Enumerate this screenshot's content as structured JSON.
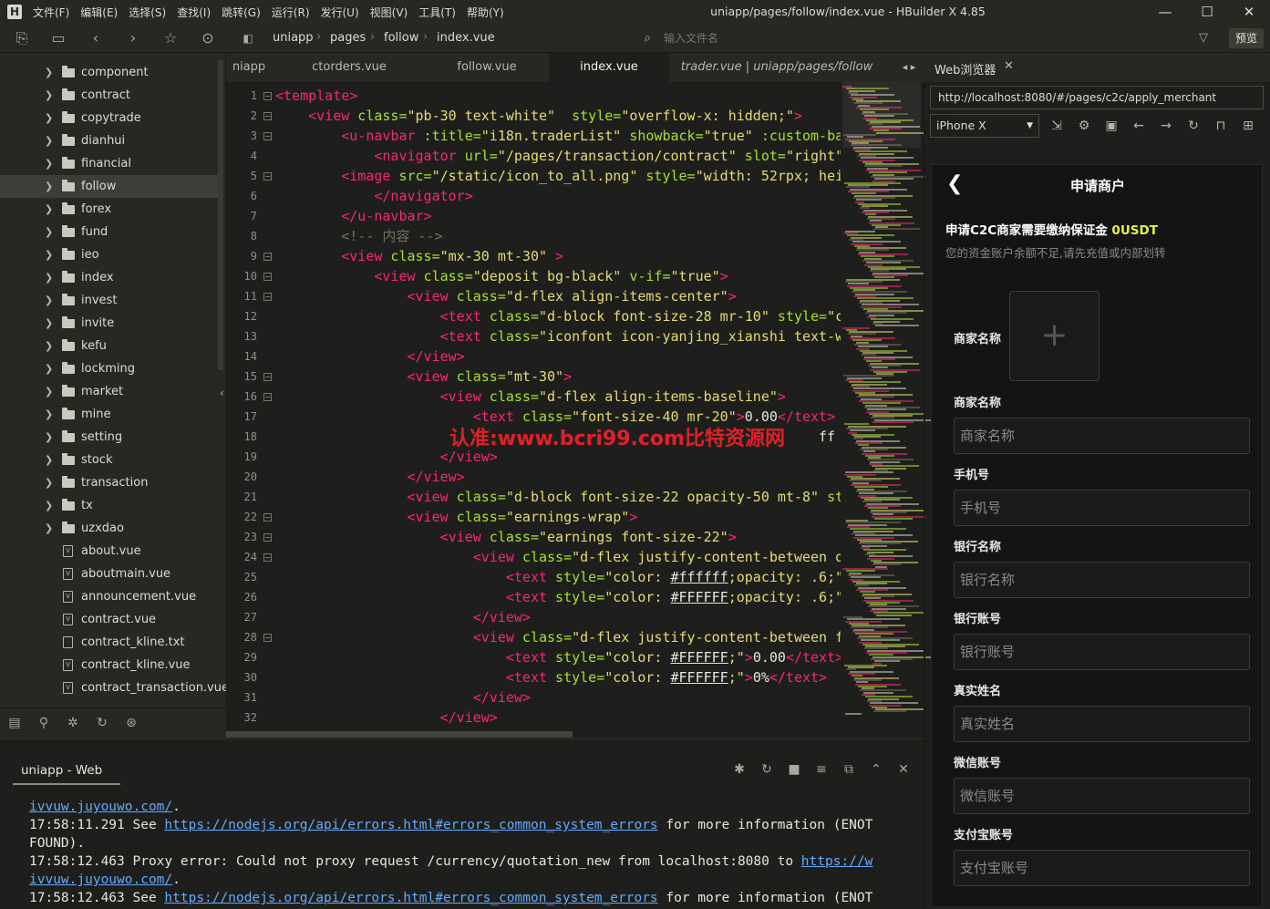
{
  "menu": {
    "items": [
      "文件(F)",
      "编辑(E)",
      "选择(S)",
      "查找(I)",
      "跳转(G)",
      "运行(R)",
      "发行(U)",
      "视图(V)",
      "工具(T)",
      "帮助(Y)"
    ],
    "window_title": "uniapp/pages/follow/index.vue - HBuilder X 4.85",
    "logo": "H",
    "controls": [
      "minimize-icon",
      "maximize-icon",
      "close-icon"
    ]
  },
  "toolbar": {
    "breadcrumb": [
      "uniapp",
      "pages",
      "follow",
      "index.vue"
    ],
    "search_placeholder": "输入文件名",
    "preview_label": "预览"
  },
  "sidebar": {
    "folders": [
      "component",
      "contract",
      "copytrade",
      "dianhui",
      "financial",
      "follow",
      "forex",
      "fund",
      "ieo",
      "index",
      "invest",
      "invite",
      "kefu",
      "lockming",
      "market",
      "mine",
      "setting",
      "stock",
      "transaction",
      "tx",
      "uzxdao"
    ],
    "files": [
      "about.vue",
      "aboutmain.vue",
      "announcement.vue",
      "contract.vue",
      "contract_kline.txt",
      "contract_kline.vue",
      "contract_transaction.vue"
    ],
    "active": "follow"
  },
  "tabs": [
    "niapp",
    "ctorders.vue",
    "follow.vue",
    "index.vue",
    "trader.vue | uniapp/pages/follow"
  ],
  "active_tab": "index.vue",
  "code": {
    "lines": [
      [
        [
          "t",
          "<template>"
        ]
      ],
      [
        [
          "e",
          "    "
        ],
        [
          "t",
          "<view"
        ],
        [
          "a",
          " class="
        ],
        [
          "s",
          "\"pb-30 text-white\""
        ],
        [
          "a",
          "  style="
        ],
        [
          "s",
          "\"overflow-x: hidden;\""
        ],
        [
          "t",
          ">"
        ]
      ],
      [
        [
          "e",
          "        "
        ],
        [
          "t",
          "<u-navbar"
        ],
        [
          "a",
          " :title="
        ],
        [
          "s",
          "\"i18n.traderList\""
        ],
        [
          "a",
          " showback="
        ],
        [
          "s",
          "\"true\""
        ],
        [
          "a",
          " :custom-ba"
        ]
      ],
      [
        [
          "e",
          "            "
        ],
        [
          "t",
          "<navigator"
        ],
        [
          "a",
          " url="
        ],
        [
          "s",
          "\"/pages/transaction/contract\""
        ],
        [
          "a",
          " slot="
        ],
        [
          "s",
          "\"right\""
        ]
      ],
      [
        [
          "e",
          "        "
        ],
        [
          "t",
          "<image"
        ],
        [
          "a",
          " src="
        ],
        [
          "s",
          "\"/static/icon_to_all.png\""
        ],
        [
          "a",
          " style="
        ],
        [
          "s",
          "\"width: 52rpx; hei"
        ]
      ],
      [
        [
          "e",
          "            "
        ],
        [
          "t",
          "</navigator>"
        ]
      ],
      [
        [
          "e",
          "        "
        ],
        [
          "t",
          "</u-navbar>"
        ]
      ],
      [
        [
          "e",
          "        "
        ],
        [
          "c",
          "<!-- 内容 -->"
        ]
      ],
      [
        [
          "e",
          "        "
        ],
        [
          "t",
          "<view"
        ],
        [
          "a",
          " class="
        ],
        [
          "s",
          "\"mx-30 mt-30\""
        ],
        [
          "t",
          " >"
        ]
      ],
      [
        [
          "e",
          "            "
        ],
        [
          "t",
          "<view"
        ],
        [
          "a",
          " class="
        ],
        [
          "s",
          "\"deposit bg-black\""
        ],
        [
          "a",
          " v-if="
        ],
        [
          "s",
          "\"true\""
        ],
        [
          "t",
          ">"
        ]
      ],
      [
        [
          "e",
          "                "
        ],
        [
          "t",
          "<view"
        ],
        [
          "a",
          " class="
        ],
        [
          "s",
          "\"d-flex align-items-center\""
        ],
        [
          "t",
          ">"
        ]
      ],
      [
        [
          "e",
          "                    "
        ],
        [
          "t",
          "<text"
        ],
        [
          "a",
          " class="
        ],
        [
          "s",
          "\"d-block font-size-28 mr-10\""
        ],
        [
          "a",
          " style="
        ],
        [
          "s",
          "\"c"
        ]
      ],
      [
        [
          "e",
          "                    "
        ],
        [
          "t",
          "<text"
        ],
        [
          "a",
          " class="
        ],
        [
          "s",
          "\"iconfont icon-yanjing_xianshi text-w"
        ]
      ],
      [
        [
          "e",
          "                "
        ],
        [
          "t",
          "</view>"
        ]
      ],
      [
        [
          "e",
          "                "
        ],
        [
          "t",
          "<view"
        ],
        [
          "a",
          " class="
        ],
        [
          "s",
          "\"mt-30\""
        ],
        [
          "t",
          ">"
        ]
      ],
      [
        [
          "e",
          "                    "
        ],
        [
          "t",
          "<view"
        ],
        [
          "a",
          " class="
        ],
        [
          "s",
          "\"d-flex align-items-baseline\""
        ],
        [
          "t",
          ">"
        ]
      ],
      [
        [
          "e",
          "                        "
        ],
        [
          "t",
          "<text"
        ],
        [
          "a",
          " class="
        ],
        [
          "s",
          "\"font-size-40 mr-20\""
        ],
        [
          "t",
          ">"
        ],
        [
          "e",
          "0.00"
        ],
        [
          "t",
          "</text>"
        ]
      ],
      [
        [
          "e",
          "                                                                  ff"
        ]
      ],
      [
        [
          "e",
          "                    "
        ],
        [
          "t",
          "</view>"
        ]
      ],
      [
        [
          "e",
          "                "
        ],
        [
          "t",
          "</view>"
        ]
      ],
      [
        [
          "e",
          "                "
        ],
        [
          "t",
          "<view"
        ],
        [
          "a",
          " class="
        ],
        [
          "s",
          "\"d-block font-size-22 opacity-50 mt-8\""
        ],
        [
          "a",
          " st"
        ]
      ],
      [
        [
          "e",
          "                "
        ],
        [
          "t",
          "<view"
        ],
        [
          "a",
          " class="
        ],
        [
          "s",
          "\"earnings-wrap\""
        ],
        [
          "t",
          ">"
        ]
      ],
      [
        [
          "e",
          "                    "
        ],
        [
          "t",
          "<view"
        ],
        [
          "a",
          " class="
        ],
        [
          "s",
          "\"earnings font-size-22\""
        ],
        [
          "t",
          ">"
        ]
      ],
      [
        [
          "e",
          "                        "
        ],
        [
          "t",
          "<view"
        ],
        [
          "a",
          " class="
        ],
        [
          "s",
          "\"d-flex justify-content-between o"
        ]
      ],
      [
        [
          "e",
          "                            "
        ],
        [
          "t",
          "<text"
        ],
        [
          "a",
          " style="
        ],
        [
          "s",
          "\"color: "
        ],
        [
          "u",
          "#ffffff"
        ],
        [
          "s",
          ";opacity: .6;\""
        ]
      ],
      [
        [
          "e",
          "                            "
        ],
        [
          "t",
          "<text"
        ],
        [
          "a",
          " style="
        ],
        [
          "s",
          "\"color: "
        ],
        [
          "u",
          "#FFFFFF"
        ],
        [
          "s",
          ";opacity: .6;\""
        ]
      ],
      [
        [
          "e",
          "                        "
        ],
        [
          "t",
          "</view>"
        ]
      ],
      [
        [
          "e",
          "                        "
        ],
        [
          "t",
          "<view"
        ],
        [
          "a",
          " class="
        ],
        [
          "s",
          "\"d-flex justify-content-between f"
        ]
      ],
      [
        [
          "e",
          "                            "
        ],
        [
          "t",
          "<text"
        ],
        [
          "a",
          " style="
        ],
        [
          "s",
          "\"color: "
        ],
        [
          "u",
          "#FFFFFF"
        ],
        [
          "s",
          ";\""
        ],
        [
          "t",
          ">"
        ],
        [
          "e",
          "0.00"
        ],
        [
          "t",
          "</text>"
        ]
      ],
      [
        [
          "e",
          "                            "
        ],
        [
          "t",
          "<text"
        ],
        [
          "a",
          " style="
        ],
        [
          "s",
          "\"color: "
        ],
        [
          "u",
          "#FFFFFF"
        ],
        [
          "s",
          ";\""
        ],
        [
          "t",
          ">"
        ],
        [
          "e",
          "0%"
        ],
        [
          "t",
          "</text>"
        ]
      ],
      [
        [
          "e",
          "                        "
        ],
        [
          "t",
          "</view>"
        ]
      ],
      [
        [
          "e",
          "                    "
        ],
        [
          "t",
          "</view>"
        ]
      ]
    ]
  },
  "watermark": "认准:www.bcri99.com比特资源网",
  "console": {
    "tab": "uniapp - Web",
    "lines": [
      [
        [
          "l",
          "ivvuw.juyouwo.com/"
        ],
        [
          "e",
          "."
        ]
      ],
      [
        [
          "e",
          "17:58:11.291 See "
        ],
        [
          "l",
          "https://nodejs.org/api/errors.html#errors_common_system_errors"
        ],
        [
          "e",
          " for more information (ENOT"
        ]
      ],
      [
        [
          "e",
          "FOUND)."
        ]
      ],
      [
        [
          "e",
          "17:58:12.463 Proxy error: Could not proxy request /currency/quotation_new from localhost:8080 to "
        ],
        [
          "l",
          "https://w"
        ]
      ],
      [
        [
          "l",
          "ivvuw.juyouwo.com/"
        ],
        [
          "e",
          "."
        ]
      ],
      [
        [
          "e",
          "17:58:12.463 See "
        ],
        [
          "l",
          "https://nodejs.org/api/errors.html#errors_common_system_errors"
        ],
        [
          "e",
          " for more information (ENOT"
        ]
      ]
    ]
  },
  "browser": {
    "tab": "Web浏览器",
    "url": "http://localhost:8080/#/pages/c2c/apply_merchant",
    "device": "iPhone X"
  },
  "phone": {
    "title": "申请商户",
    "notice_prefix": "申请C2C商家需要缴纳保证金",
    "notice_amount": "0USDT",
    "subtitle": "您的资金账户余额不足,请先充值或内部划转",
    "upload_label": "商家名称",
    "fields": [
      {
        "label": "商家名称",
        "placeholder": "商家名称"
      },
      {
        "label": "手机号",
        "placeholder": "手机号"
      },
      {
        "label": "银行名称",
        "placeholder": "银行名称"
      },
      {
        "label": "银行账号",
        "placeholder": "银行账号"
      },
      {
        "label": "真实姓名",
        "placeholder": "真实姓名"
      },
      {
        "label": "微信账号",
        "placeholder": "微信账号"
      },
      {
        "label": "支付宝账号",
        "placeholder": "支付宝账号"
      }
    ]
  }
}
